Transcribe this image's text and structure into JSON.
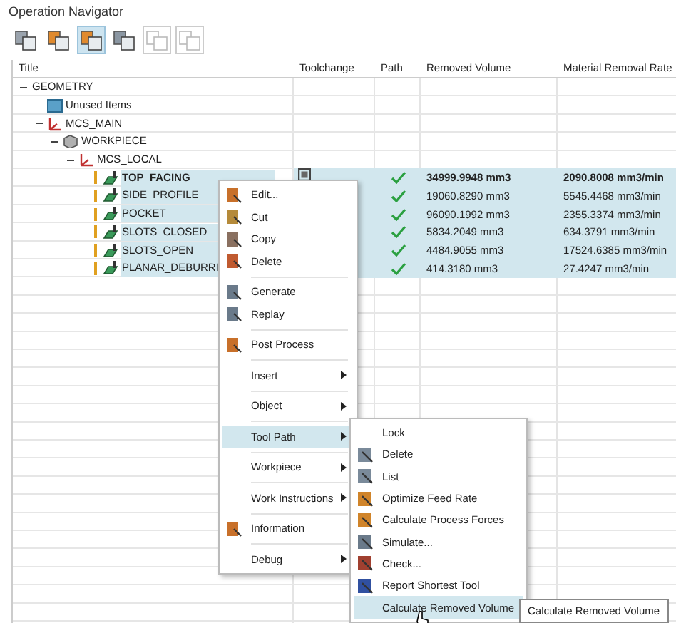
{
  "panel": {
    "title": "Operation Navigator"
  },
  "toolbar": [
    {
      "selected": false,
      "disabled": false
    },
    {
      "selected": false,
      "disabled": false
    },
    {
      "selected": true,
      "disabled": false
    },
    {
      "selected": false,
      "disabled": false
    },
    {
      "selected": false,
      "disabled": true
    },
    {
      "selected": false,
      "disabled": true
    }
  ],
  "table": {
    "columns": [
      "Title",
      "Toolchange",
      "Path",
      "Removed Volume",
      "Material Removal Rate"
    ],
    "tree": [
      {
        "name": "GEOMETRY",
        "expanded": true,
        "children": [
          {
            "kind": "folder",
            "name": "Unused Items"
          },
          {
            "kind": "mcs",
            "name": "MCS_MAIN",
            "expanded": true,
            "children": [
              {
                "kind": "workpiece",
                "name": "WORKPIECE",
                "expanded": true,
                "children": [
                  {
                    "kind": "mcs",
                    "name": "MCS_LOCAL",
                    "expanded": true,
                    "children": [
                      {
                        "kind": "operation",
                        "name": "TOP_FACING",
                        "selected": true,
                        "current": true,
                        "toolchange": true,
                        "path_ok": true,
                        "removed_volume": "34999.9948 mm3",
                        "removal_rate": "2090.8008 mm3/min"
                      },
                      {
                        "kind": "operation",
                        "name": "SIDE_PROFILE",
                        "selected": true,
                        "current": false,
                        "path_ok": true,
                        "removed_volume": "19060.8290 mm3",
                        "removal_rate": "5545.4468 mm3/min"
                      },
                      {
                        "kind": "operation",
                        "name": "POCKET",
                        "selected": true,
                        "current": false,
                        "path_ok": true,
                        "removed_volume": "96090.1992 mm3",
                        "removal_rate": "2355.3374 mm3/min"
                      },
                      {
                        "kind": "operation",
                        "name": "SLOTS_CLOSED",
                        "selected": true,
                        "current": false,
                        "path_ok": true,
                        "removed_volume": "5834.2049 mm3",
                        "removal_rate": "634.3791 mm3/min"
                      },
                      {
                        "kind": "operation",
                        "name": "SLOTS_OPEN",
                        "selected": true,
                        "current": false,
                        "path_ok": true,
                        "removed_volume": "4484.9055 mm3",
                        "removal_rate": "17524.6385 mm3/min"
                      },
                      {
                        "kind": "operation",
                        "name": "PLANAR_DEBURRI",
                        "selected": true,
                        "current": false,
                        "path_ok": true,
                        "removed_volume": "414.3180 mm3",
                        "removal_rate": "27.4247 mm3/min"
                      }
                    ]
                  }
                ]
              }
            ]
          }
        ]
      }
    ]
  },
  "context_menu": {
    "groups": [
      [
        {
          "label": "Edit...",
          "kind": "icon",
          "submenu": false,
          "selected": false
        },
        {
          "label": "Cut",
          "kind": "icon",
          "submenu": false,
          "selected": false
        },
        {
          "label": "Copy",
          "kind": "icon",
          "submenu": false,
          "selected": false
        },
        {
          "label": "Delete",
          "kind": "icon",
          "submenu": false,
          "selected": false
        }
      ],
      [
        {
          "label": "Generate",
          "kind": "icon",
          "submenu": false,
          "selected": false
        },
        {
          "label": "Replay",
          "kind": "icon",
          "submenu": false,
          "selected": false
        }
      ],
      [
        {
          "label": "Post Process",
          "kind": "icon",
          "submenu": false,
          "selected": false
        }
      ],
      [
        {
          "label": "Insert",
          "kind": "plain",
          "submenu": true,
          "selected": false
        }
      ],
      [
        {
          "label": "Object",
          "kind": "plain",
          "submenu": true,
          "selected": false
        }
      ],
      [
        {
          "label": "Tool Path",
          "kind": "plain",
          "submenu": true,
          "selected": true
        }
      ],
      [
        {
          "label": "Workpiece",
          "kind": "plain",
          "submenu": true,
          "selected": false
        }
      ],
      [
        {
          "label": "Work Instructions",
          "kind": "plain",
          "submenu": true,
          "selected": false
        }
      ],
      [
        {
          "label": "Information",
          "kind": "icon",
          "submenu": false,
          "selected": false
        }
      ],
      [
        {
          "label": "Debug",
          "kind": "plain",
          "submenu": true,
          "selected": false
        }
      ]
    ]
  },
  "submenu": {
    "items": [
      {
        "label": "Lock",
        "kind": "plain",
        "selected": false
      },
      {
        "label": "Delete",
        "kind": "icon",
        "selected": false
      },
      {
        "label": "List",
        "kind": "icon",
        "selected": false
      },
      {
        "label": "Optimize Feed Rate",
        "kind": "icon",
        "selected": false
      },
      {
        "label": "Calculate Process Forces",
        "kind": "icon",
        "selected": false
      },
      {
        "label": "Simulate...",
        "kind": "icon",
        "selected": false
      },
      {
        "label": "Check...",
        "kind": "icon",
        "selected": false
      },
      {
        "label": "Report Shortest Tool",
        "kind": "icon",
        "selected": false
      },
      {
        "label": "Calculate Removed Volume",
        "kind": "plain",
        "selected": true
      }
    ]
  },
  "tooltip": {
    "text": "Calculate Removed Volume"
  }
}
